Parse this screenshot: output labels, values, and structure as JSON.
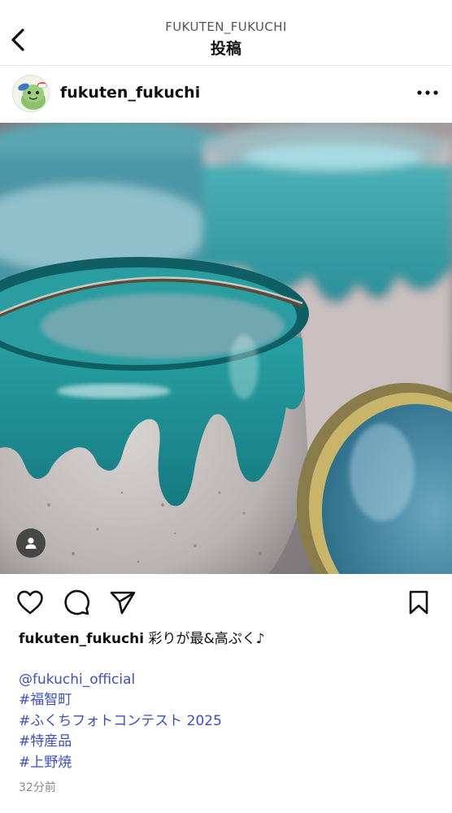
{
  "header": {
    "account": "FUKUTEN_FUKUCHI",
    "title": "投稿"
  },
  "post": {
    "username": "fukuten_fukuchi",
    "caption_text": "彩りが最&高ぷく♪",
    "mentions": [
      "@fukuchi_official"
    ],
    "hashtags": [
      "#福智町",
      "#ふくちフォトコンテスト 2025",
      "#特産品",
      "#上野焼"
    ],
    "timestamp": "32分前"
  },
  "icons": {
    "back": "chevron-left-icon",
    "more": "more-horizontal-icon",
    "like": "heart-icon",
    "comment": "comment-icon",
    "share": "send-icon",
    "save": "bookmark-icon",
    "tagged": "person-icon"
  },
  "colors": {
    "link": "#3b4fc4",
    "glaze": "#1f8f92",
    "text": "#111111",
    "muted": "#8a8a8a"
  }
}
